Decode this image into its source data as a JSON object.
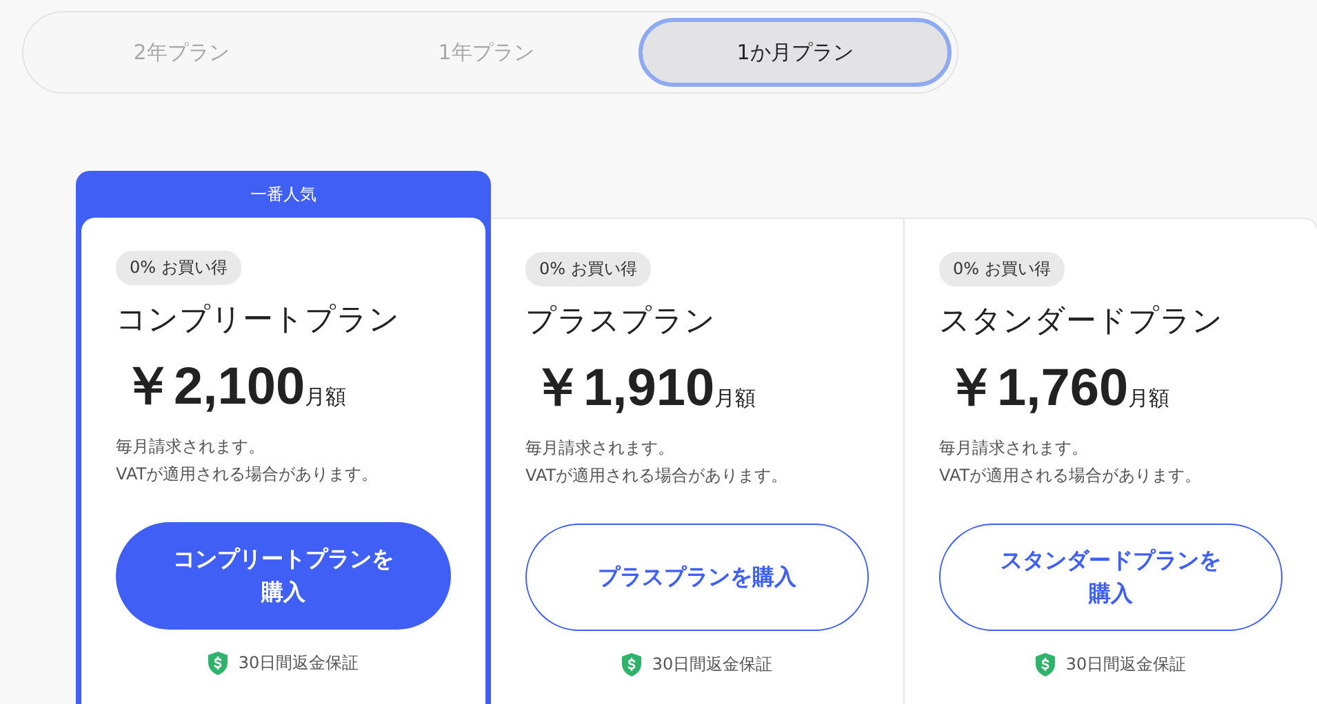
{
  "tabs": [
    {
      "label": "2年プラン",
      "selected": false
    },
    {
      "label": "1年プラン",
      "selected": false
    },
    {
      "label": "1か月プラン",
      "selected": true
    }
  ],
  "plans": [
    {
      "banner": "一番人気",
      "featured": true,
      "badge": "0% お買い得",
      "name": "コンプリートプラン",
      "price": "￥2,100",
      "unit": "月額",
      "notes": [
        "毎月請求されます。",
        "VATが適用される場合があります。"
      ],
      "button": "コンプリートプランを購入",
      "guarantee": "30日間返金保証"
    },
    {
      "featured": false,
      "badge": "0% お買い得",
      "name": "プラスプラン",
      "price": "￥1,910",
      "unit": "月額",
      "notes": [
        "毎月請求されます。",
        "VATが適用される場合があります。"
      ],
      "button": "プラスプランを購入",
      "guarantee": "30日間返金保証"
    },
    {
      "featured": false,
      "badge": "0% お買い得",
      "name": "スタンダードプラン",
      "price": "￥1,760",
      "unit": "月額",
      "notes": [
        "毎月請求されます。",
        "VATが適用される場合があります。"
      ],
      "button": "スタンダードプランを購入",
      "guarantee": "30日間返金保証"
    }
  ]
}
